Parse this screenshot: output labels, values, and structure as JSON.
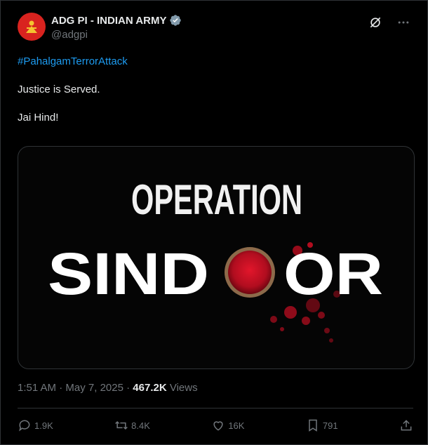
{
  "author": {
    "display_name": "ADG PI - INDIAN ARMY",
    "handle": "@adgpi",
    "avatar": "army-emblem-icon",
    "verified": "verified-badge-icon"
  },
  "tweet": {
    "hashtag": "#PahalgamTerrorAttack",
    "line1": "Justice is Served.",
    "line2": "Jai Hind!"
  },
  "media": {
    "word1": "OPERATION",
    "word2_part1": "SIND",
    "word2_part2": "OR",
    "accent_color": "#c8102e"
  },
  "meta": {
    "time": "1:51 AM",
    "separator": " · ",
    "date": "May 7, 2025",
    "views_count": "467.2K",
    "views_label": "Views"
  },
  "actions": {
    "reply": "1.9K",
    "retweet": "8.4K",
    "like": "16K",
    "bookmark": "791"
  }
}
